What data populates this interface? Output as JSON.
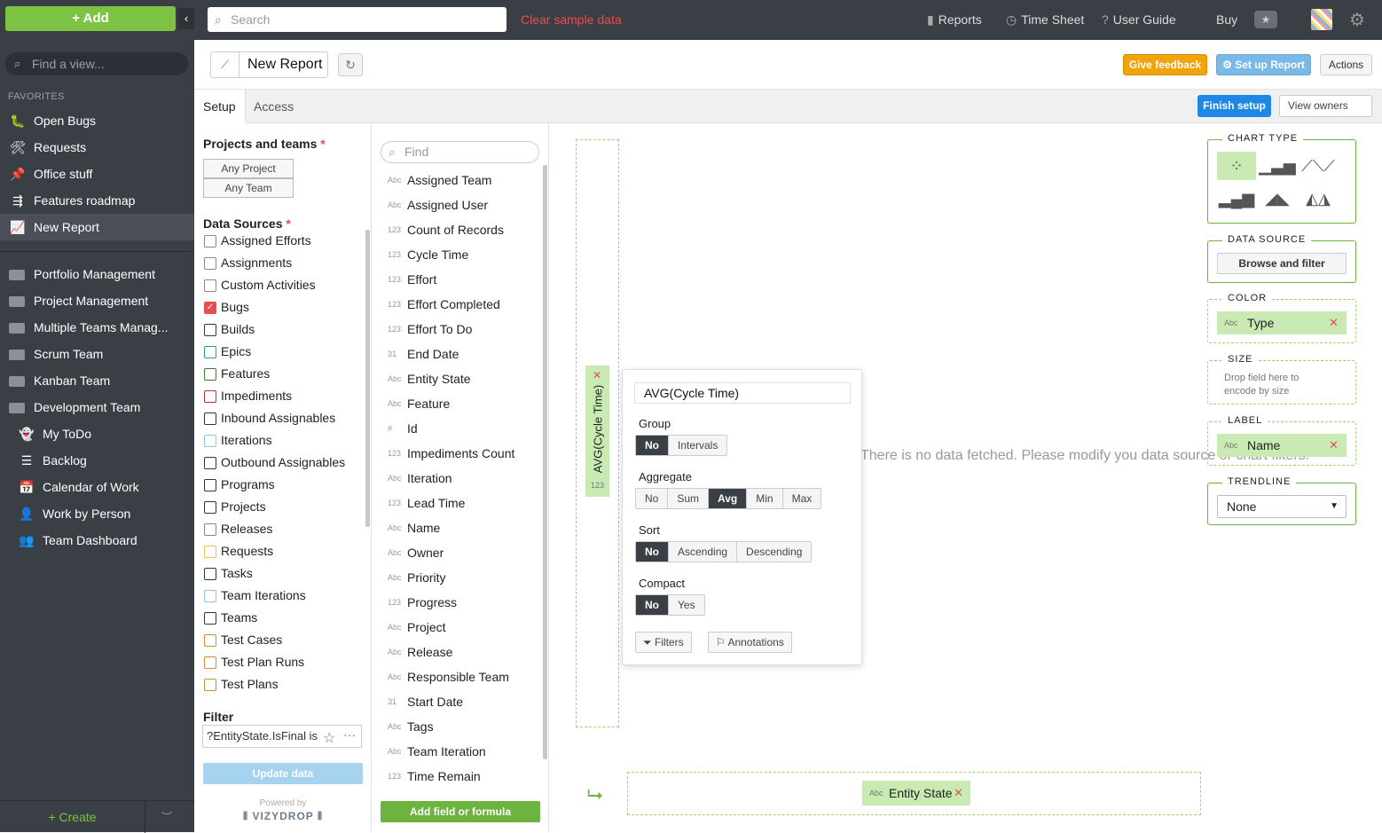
{
  "sidebar": {
    "add_label": "+ Add",
    "find_placeholder": "Find a view...",
    "favorites_label": "FAVORITES",
    "favorites": [
      {
        "label": "Open Bugs",
        "icon": "bug-icon"
      },
      {
        "label": "Requests",
        "icon": "tools-icon"
      },
      {
        "label": "Office stuff",
        "icon": "pin-icon"
      },
      {
        "label": "Features roadmap",
        "icon": "roadmap-icon"
      },
      {
        "label": "New Report",
        "icon": "chart-icon"
      }
    ],
    "folders": [
      {
        "label": "Portfolio Management"
      },
      {
        "label": "Project  Management"
      },
      {
        "label": "Multiple Teams Manag..."
      },
      {
        "label": "Scrum Team"
      },
      {
        "label": "Kanban Team"
      },
      {
        "label": "Development Team"
      }
    ],
    "subitems": [
      {
        "label": "My ToDo",
        "icon": "ghost-icon"
      },
      {
        "label": "Backlog",
        "icon": "list-icon"
      },
      {
        "label": "Calendar of Work",
        "icon": "calendar-icon"
      },
      {
        "label": "Work by Person",
        "icon": "person-icon"
      },
      {
        "label": "Team Dashboard",
        "icon": "team-icon"
      }
    ],
    "create_label": "+ Create"
  },
  "topbar": {
    "search_placeholder": "Search",
    "clear_label": "Clear sample data",
    "reports": "Reports",
    "timesheet": "Time Sheet",
    "userguide": "User Guide",
    "buy": "Buy"
  },
  "report": {
    "title": "New Report",
    "feedback": "Give feedback",
    "setup": "Set up Report",
    "actions": "Actions",
    "tab_setup": "Setup",
    "tab_access": "Access",
    "finish": "Finish setup",
    "view_owners": "View owners"
  },
  "setup_panel": {
    "projects_label": "Projects and teams",
    "any_project": "Any Project",
    "any_team": "Any Team",
    "datasources_label": "Data Sources",
    "datasources": [
      {
        "label": "Assigned Efforts",
        "checked": false,
        "color": "#888888"
      },
      {
        "label": "Assignments",
        "checked": false,
        "color": "#888888"
      },
      {
        "label": "Custom Activities",
        "checked": false,
        "color": "#888888"
      },
      {
        "label": "Bugs",
        "checked": true,
        "color": "#e84e4e"
      },
      {
        "label": "Builds",
        "checked": false,
        "color": "#333333"
      },
      {
        "label": "Epics",
        "checked": false,
        "color": "#2a9d8f"
      },
      {
        "label": "Features",
        "checked": false,
        "color": "#3a7d2a"
      },
      {
        "label": "Impediments",
        "checked": false,
        "color": "#a33a3a"
      },
      {
        "label": "Inbound Assignables",
        "checked": false,
        "color": "#333333"
      },
      {
        "label": "Iterations",
        "checked": false,
        "color": "#8fc5e8"
      },
      {
        "label": "Outbound Assignables",
        "checked": false,
        "color": "#333333"
      },
      {
        "label": "Programs",
        "checked": false,
        "color": "#333333"
      },
      {
        "label": "Projects",
        "checked": false,
        "color": "#333333"
      },
      {
        "label": "Releases",
        "checked": false,
        "color": "#888888"
      },
      {
        "label": "Requests",
        "checked": false,
        "color": "#f0c040"
      },
      {
        "label": "Tasks",
        "checked": false,
        "color": "#333333"
      },
      {
        "label": "Team Iterations",
        "checked": false,
        "color": "#8fc5e8"
      },
      {
        "label": "Teams",
        "checked": false,
        "color": "#333333"
      },
      {
        "label": "Test Cases",
        "checked": false,
        "color": "#d48a3a"
      },
      {
        "label": "Test Plan Runs",
        "checked": false,
        "color": "#d48a3a"
      },
      {
        "label": "Test Plans",
        "checked": false,
        "color": "#d48a3a"
      }
    ],
    "filter_label": "Filter",
    "filter_value": "?EntityState.IsFinal is",
    "update": "Update data",
    "powered": "Powered by",
    "brand": "VIZYDROP"
  },
  "fields_panel": {
    "find_placeholder": "Find",
    "fields": [
      {
        "type": "Abc",
        "label": "Assigned Team"
      },
      {
        "type": "Abc",
        "label": "Assigned User"
      },
      {
        "type": "123",
        "label": "Count of Records"
      },
      {
        "type": "123",
        "label": "Cycle Time"
      },
      {
        "type": "123",
        "label": "Effort"
      },
      {
        "type": "123",
        "label": "Effort Completed"
      },
      {
        "type": "123",
        "label": "Effort To Do"
      },
      {
        "type": "31",
        "label": "End Date"
      },
      {
        "type": "Abc",
        "label": "Entity State"
      },
      {
        "type": "Abc",
        "label": "Feature"
      },
      {
        "type": "#",
        "label": "Id"
      },
      {
        "type": "123",
        "label": "Impediments Count"
      },
      {
        "type": "Abc",
        "label": "Iteration"
      },
      {
        "type": "123",
        "label": "Lead Time"
      },
      {
        "type": "Abc",
        "label": "Name"
      },
      {
        "type": "Abc",
        "label": "Owner"
      },
      {
        "type": "Abc",
        "label": "Priority"
      },
      {
        "type": "123",
        "label": "Progress"
      },
      {
        "type": "Abc",
        "label": "Project"
      },
      {
        "type": "Abc",
        "label": "Release"
      },
      {
        "type": "Abc",
        "label": "Responsible Team"
      },
      {
        "type": "31",
        "label": "Start Date"
      },
      {
        "type": "Abc",
        "label": "Tags"
      },
      {
        "type": "Abc",
        "label": "Team Iteration"
      },
      {
        "type": "123",
        "label": "Time Remain"
      }
    ],
    "add_field": "Add field or formula"
  },
  "canvas": {
    "y_field": "AVG(Cycle Time)",
    "y_type": "123",
    "x_field": "Entity State",
    "x_type": "Abc",
    "nodata_msg": "There is no data fetched. Please modify you data source or chart filters."
  },
  "popup": {
    "title": "AVG(Cycle Time)",
    "group_label": "Group",
    "group_options": [
      "No",
      "Intervals"
    ],
    "group_selected": "No",
    "aggregate_label": "Aggregate",
    "aggregate_options": [
      "No",
      "Sum",
      "Avg",
      "Min",
      "Max"
    ],
    "aggregate_selected": "Avg",
    "sort_label": "Sort",
    "sort_options": [
      "No",
      "Ascending",
      "Descending"
    ],
    "sort_selected": "No",
    "compact_label": "Compact",
    "compact_options": [
      "No",
      "Yes"
    ],
    "compact_selected": "No",
    "filters": "Filters",
    "annotations": "Annotations"
  },
  "right_panel": {
    "chart_type_label": "CHART TYPE",
    "chart_types": [
      "scatter",
      "bar",
      "line",
      "stacked-bar",
      "area",
      "stacked-area"
    ],
    "chart_type_selected": "scatter",
    "datasource_label": "DATA SOURCE",
    "browse": "Browse and filter",
    "color_label": "COLOR",
    "color_field": "Type",
    "size_label": "SIZE",
    "size_hint": "Drop field here to encode by size",
    "label_label": "LABEL",
    "label_field": "Name",
    "trendline_label": "TRENDLINE",
    "trendline_value": "None"
  }
}
